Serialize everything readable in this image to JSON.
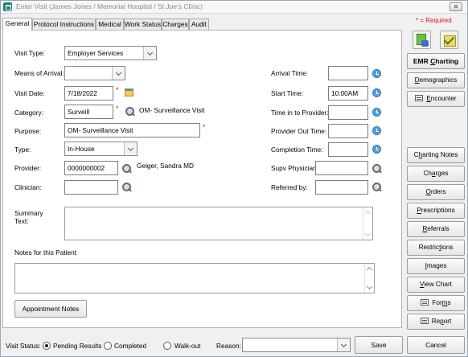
{
  "window": {
    "title": "Enter Visit (James Jones / Memorial Hospital / St Joe's Clinic)",
    "close_label": "✕"
  },
  "tabs": [
    {
      "label": "General",
      "active": true
    },
    {
      "label": "Protocol Instructions"
    },
    {
      "label": "Medical"
    },
    {
      "label": "Work Status"
    },
    {
      "label": "Charges"
    },
    {
      "label": "Audit"
    }
  ],
  "required_note": "* = Required",
  "required_mark": "*",
  "form": {
    "visit_type": {
      "label": "Visit Type:",
      "value": "Employer Services"
    },
    "means_of_arrival": {
      "label": "Means of Arrival:",
      "value": ""
    },
    "visit_date": {
      "label": "Visit Date:",
      "value": "7/18/2022"
    },
    "category": {
      "label": "Category:",
      "value": "Surveill",
      "description": "OM- Surveillance Visit"
    },
    "purpose": {
      "label": "Purpose:",
      "value": "OM- Surveillance Visit"
    },
    "type": {
      "label": "Type:",
      "value": "In-House"
    },
    "provider": {
      "label": "Provider:",
      "value": "0000000002",
      "name": "Geiger, Sandra  MD"
    },
    "clinician": {
      "label": "Clinician:",
      "value": ""
    },
    "arrival_time": {
      "label": "Arrival Time:",
      "value": ""
    },
    "start_time": {
      "label": "Start Time:",
      "value": "10:00AM"
    },
    "time_in_to_provider": {
      "label": "Time in to Provider:",
      "value": ""
    },
    "provider_out_time": {
      "label": "Provider Out Time:",
      "value": ""
    },
    "completion_time": {
      "label": "Completion Time:",
      "value": ""
    },
    "supv_physician": {
      "label": "Supv Physician:",
      "value": ""
    },
    "referred_by": {
      "label": "Referred by:",
      "value": ""
    },
    "summary_text": {
      "label_line1": "Summary",
      "label_line2": "Text:",
      "value": ""
    },
    "notes_for_patient": {
      "label": "Notes for this Patient",
      "value": ""
    }
  },
  "appointment_notes_label": "Appointment Notes",
  "side_buttons": {
    "emr_charting": {
      "before": "EMR ",
      "u": "C",
      "after": "harting"
    },
    "demographics": {
      "before": "",
      "u": "D",
      "after": "emographics"
    },
    "encounter": {
      "before": "",
      "u": "E",
      "after": "ncounter"
    },
    "charting_notes": {
      "before": "C",
      "u": "h",
      "after": "arting Notes"
    },
    "charges": {
      "before": "Ch",
      "u": "a",
      "after": "rges"
    },
    "orders": {
      "before": "",
      "u": "O",
      "after": "rders"
    },
    "prescriptions": {
      "before": "",
      "u": "P",
      "after": "rescriptions"
    },
    "referrals": {
      "before": "",
      "u": "R",
      "after": "eferrals"
    },
    "restrictions": {
      "before": "Restric",
      "u": "t",
      "after": "ions"
    },
    "images": {
      "before": "",
      "u": "I",
      "after": "mages"
    },
    "view_chart": {
      "before": "",
      "u": "V",
      "after": "iew Chart"
    },
    "forms": {
      "before": "For",
      "u": "m",
      "after": "s"
    },
    "report": {
      "before": "Re",
      "u": "p",
      "after": "ort"
    }
  },
  "bottom": {
    "visit_status_label": "Visit Status:",
    "options": [
      {
        "label": "Pending Results",
        "checked": true
      },
      {
        "label": "Completed",
        "checked": false
      },
      {
        "label": "Walk-out",
        "checked": false
      }
    ],
    "reason_label": "Reason:",
    "reason_value": "",
    "save_label": "Save",
    "cancel_label": "Cancel"
  },
  "colors": {
    "required": "#e1131c",
    "accent": "#1c7f73"
  },
  "icons": [
    "app-icon",
    "close-icon",
    "search-icon",
    "calendar-icon",
    "clock-icon",
    "printer-icon",
    "emr-icon",
    "checklist-icon"
  ]
}
